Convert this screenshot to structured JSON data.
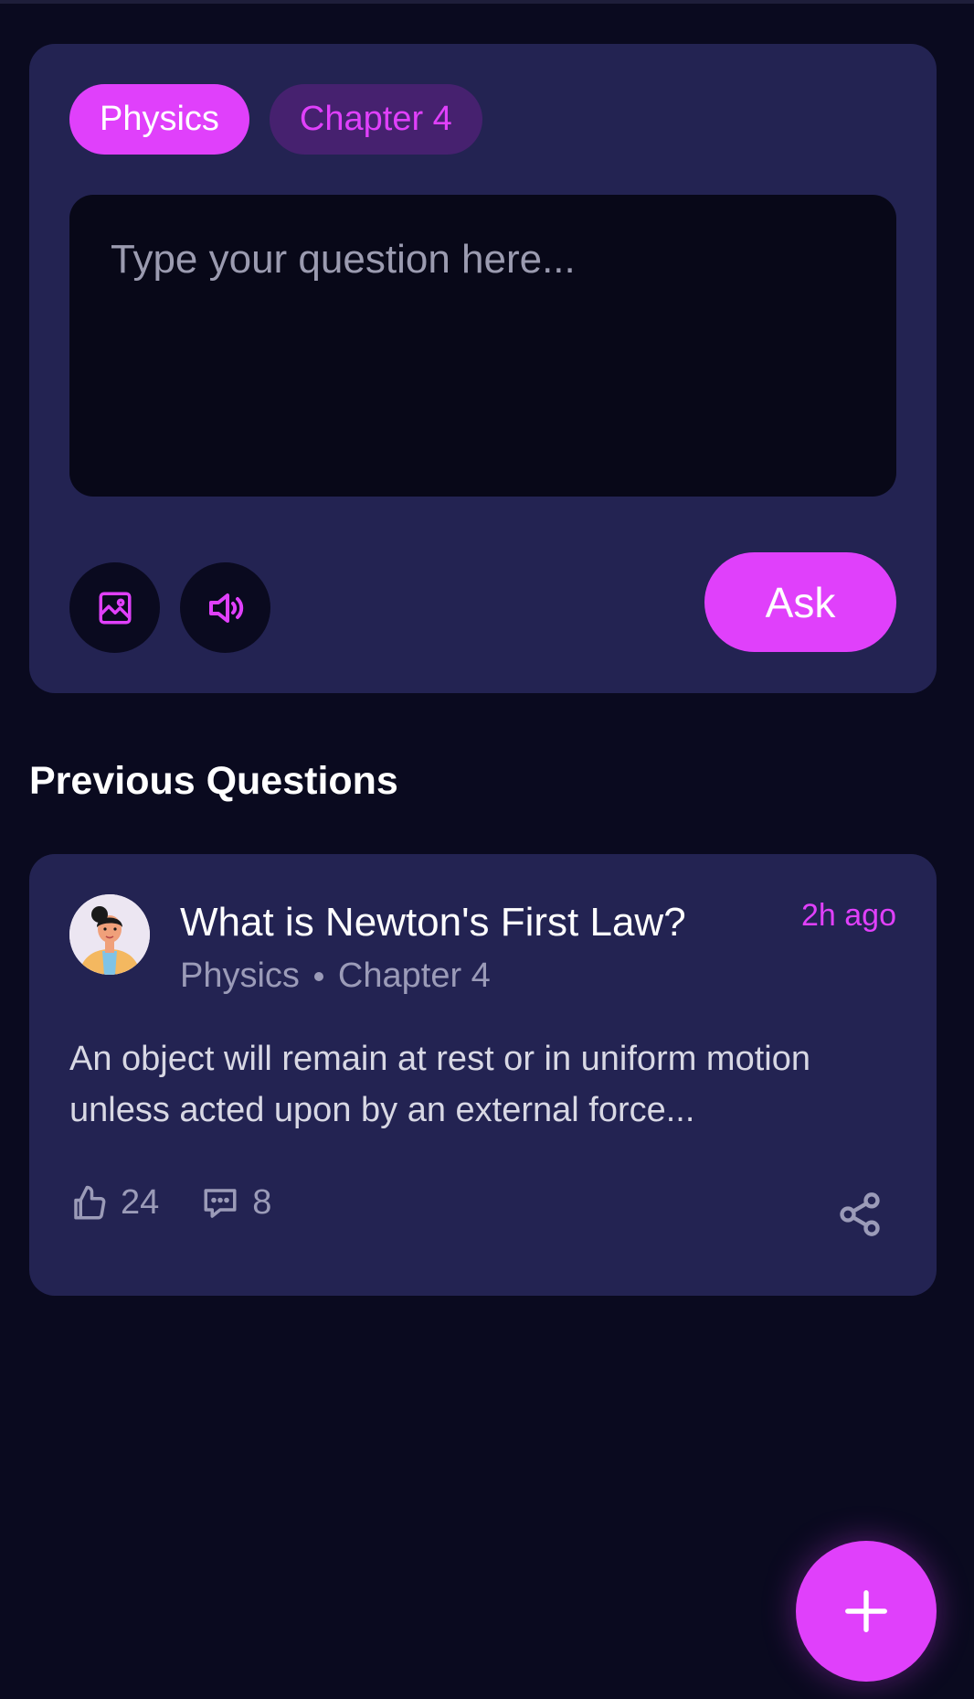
{
  "composer": {
    "subject_chip": "Physics",
    "chapter_chip": "Chapter 4",
    "placeholder": "Type your question here...",
    "image_icon": "image-icon",
    "audio_icon": "speaker-icon",
    "ask_label": "Ask"
  },
  "previous": {
    "heading": "Previous Questions",
    "items": [
      {
        "title": "What is Newton's First Law?",
        "time": "2h ago",
        "subject": "Physics",
        "chapter": "Chapter 4",
        "excerpt": "An object will remain at rest or in uniform motion unless acted upon by an external force...",
        "likes": "24",
        "comments": "8"
      }
    ]
  },
  "fab": {
    "icon": "plus-icon"
  },
  "colors": {
    "background": "#0a0a1f",
    "card": "#232352",
    "accent": "#e040fb",
    "input": "#080818",
    "muted": "#9b9bb8"
  }
}
